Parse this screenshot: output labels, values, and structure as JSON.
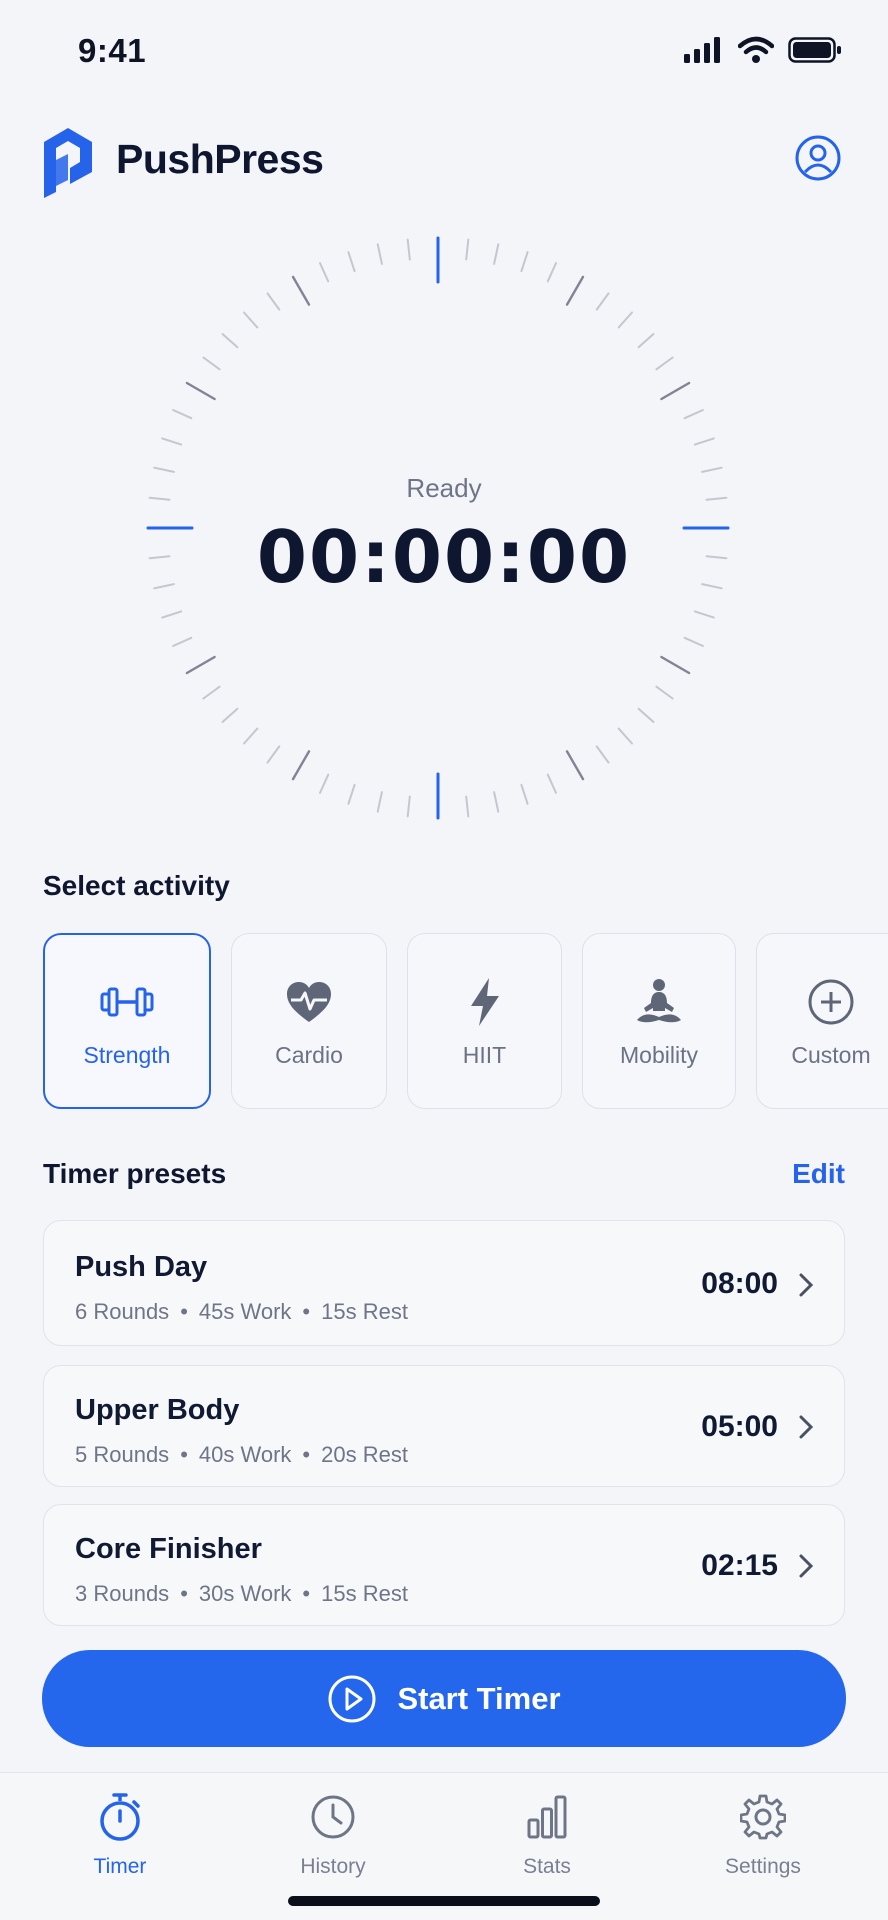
{
  "status_bar": {
    "time": "9:41"
  },
  "header": {
    "brand": "PushPress",
    "logo_icon": "pushpress-logo-icon",
    "profile_icon": "user-circle-icon"
  },
  "dial": {
    "status": "Ready",
    "time": "00:00:00",
    "accent": "#2563eb"
  },
  "activity_section": {
    "title": "Select activity",
    "items": [
      {
        "label": "Strength",
        "icon": "dumbbell-icon",
        "selected": true
      },
      {
        "label": "Cardio",
        "icon": "heart-pulse-icon",
        "selected": false
      },
      {
        "label": "HIIT",
        "icon": "lightning-icon",
        "selected": false
      },
      {
        "label": "Mobility",
        "icon": "meditation-icon",
        "selected": false
      },
      {
        "label": "Custom",
        "icon": "plus-circle-icon",
        "selected": false
      }
    ]
  },
  "presets": {
    "title": "Timer presets",
    "edit_label": "Edit",
    "items": [
      {
        "name": "Push Day",
        "rounds": "6 Rounds",
        "work": "45s Work",
        "rest": "15s Rest",
        "duration": "08:00"
      },
      {
        "name": "Upper Body",
        "rounds": "5 Rounds",
        "work": "40s Work",
        "rest": "20s Rest",
        "duration": "05:00"
      },
      {
        "name": "Core Finisher",
        "rounds": "3 Rounds",
        "work": "30s Work",
        "rest": "15s Rest",
        "duration": "02:15"
      }
    ],
    "separator": "•"
  },
  "start_button": {
    "label": "Start Timer",
    "icon": "play-circle-icon",
    "color": "#2466ec"
  },
  "tabbar": {
    "items": [
      {
        "label": "Timer",
        "icon": "stopwatch-icon",
        "active": true
      },
      {
        "label": "History",
        "icon": "clock-icon",
        "active": false
      },
      {
        "label": "Stats",
        "icon": "bar-chart-icon",
        "active": false
      },
      {
        "label": "Settings",
        "icon": "gear-icon",
        "active": false
      }
    ]
  }
}
